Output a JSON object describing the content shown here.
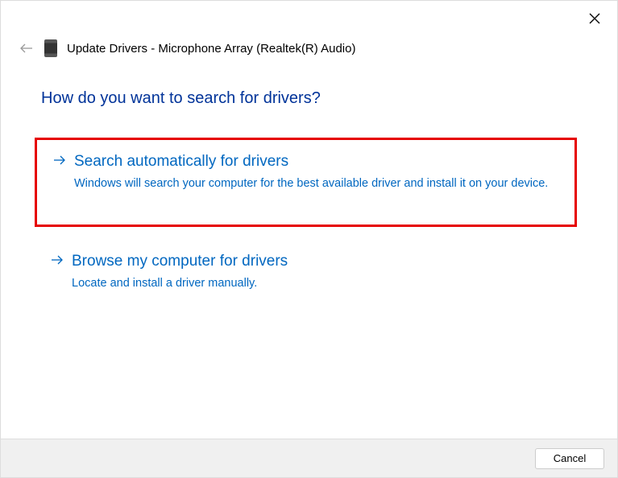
{
  "header": {
    "title": "Update Drivers - Microphone Array (Realtek(R) Audio)"
  },
  "question": "How do you want to search for drivers?",
  "options": [
    {
      "title": "Search automatically for drivers",
      "description": "Windows will search your computer for the best available driver and install it on your device.",
      "highlighted": true
    },
    {
      "title": "Browse my computer for drivers",
      "description": "Locate and install a driver manually.",
      "highlighted": false
    }
  ],
  "footer": {
    "cancel_label": "Cancel"
  }
}
